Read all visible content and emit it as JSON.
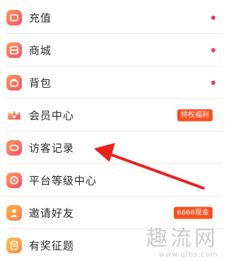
{
  "menu": {
    "items": [
      {
        "label": "充值",
        "icon": "recharge-icon",
        "badge": "",
        "dot": true
      },
      {
        "label": "商城",
        "icon": "shop-icon",
        "badge": "",
        "dot": true
      },
      {
        "label": "背包",
        "icon": "backpack-icon",
        "badge": "",
        "dot": true
      },
      {
        "label": "会员中心",
        "icon": "crown-icon",
        "badge": "特权福利",
        "dot": false
      },
      {
        "label": "访客记录",
        "icon": "eye-icon",
        "badge": "",
        "dot": false
      },
      {
        "label": "平台等级中心",
        "icon": "level-icon",
        "badge": "",
        "dot": false
      },
      {
        "label": "邀请好友",
        "icon": "invite-friends-icon",
        "badge": "6666现金",
        "dot": false
      },
      {
        "label": "有奖征题",
        "icon": "document-icon",
        "badge": "",
        "dot": false
      }
    ]
  },
  "watermark": {
    "main": "趣流网",
    "url": "www.qlbs.com"
  },
  "colors": {
    "accent": "#f0355a",
    "badge": "#fc4e1f",
    "arrow": "#e8221f",
    "icon_gradient": [
      "#ff9a56",
      "#fb4d6a"
    ]
  }
}
